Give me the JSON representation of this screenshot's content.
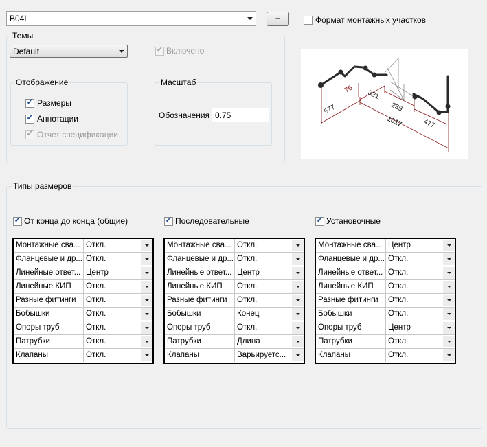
{
  "top": {
    "spec_combo_value": "B04L",
    "add_button_label": "+",
    "format_checkbox_label": "Формат монтажных участков",
    "format_checked": false
  },
  "themes": {
    "group_title": "Темы",
    "theme_combo_value": "Default",
    "enabled_label": "Включено",
    "enabled_checked": true,
    "display": {
      "title": "Отображение",
      "items": [
        {
          "label": "Размеры",
          "checked": true,
          "disabled": false
        },
        {
          "label": "Аннотации",
          "checked": true,
          "disabled": false
        },
        {
          "label": "Отчет спецификации",
          "checked": true,
          "disabled": true
        }
      ]
    },
    "scale": {
      "title": "Масштаб",
      "label": "Обозначения",
      "value": "0.75"
    }
  },
  "preview": {
    "dimensions": [
      "76",
      "321",
      "239",
      "577",
      "1017",
      "477"
    ],
    "line_color": "#2b2b2b",
    "dim_color": "#8a1b1b"
  },
  "dimension_types": {
    "title": "Типы размеров",
    "columns": [
      {
        "label": "От конца до конца (общие)",
        "checked": true,
        "rows": [
          {
            "name": "Монтажные сва...",
            "value": "Откл."
          },
          {
            "name": "Фланцевые и др...",
            "value": "Откл."
          },
          {
            "name": "Линейные ответ...",
            "value": "Центр"
          },
          {
            "name": "Линейные КИП",
            "value": "Откл."
          },
          {
            "name": "Разные фитинги",
            "value": "Откл."
          },
          {
            "name": "Бобышки",
            "value": "Откл."
          },
          {
            "name": "Опоры труб",
            "value": "Откл."
          },
          {
            "name": "Патрубки",
            "value": "Откл."
          },
          {
            "name": "Клапаны",
            "value": "Откл."
          }
        ]
      },
      {
        "label": "Последовательные",
        "checked": true,
        "rows": [
          {
            "name": "Монтажные сва...",
            "value": "Откл."
          },
          {
            "name": "Фланцевые и др...",
            "value": "Откл."
          },
          {
            "name": "Линейные ответ...",
            "value": "Центр"
          },
          {
            "name": "Линейные КИП",
            "value": "Откл."
          },
          {
            "name": "Разные фитинги",
            "value": "Откл."
          },
          {
            "name": "Бобышки",
            "value": "Конец"
          },
          {
            "name": "Опоры труб",
            "value": "Откл."
          },
          {
            "name": "Патрубки",
            "value": "Длина"
          },
          {
            "name": "Клапаны",
            "value": "Варьируетс..."
          }
        ]
      },
      {
        "label": "Установочные",
        "checked": true,
        "rows": [
          {
            "name": "Монтажные сва...",
            "value": "Центр"
          },
          {
            "name": "Фланцевые и др...",
            "value": "Откл."
          },
          {
            "name": "Линейные ответ...",
            "value": "Откл."
          },
          {
            "name": "Линейные КИП",
            "value": "Откл."
          },
          {
            "name": "Разные фитинги",
            "value": "Откл."
          },
          {
            "name": "Бобышки",
            "value": "Откл."
          },
          {
            "name": "Опоры труб",
            "value": "Центр"
          },
          {
            "name": "Патрубки",
            "value": "Откл."
          },
          {
            "name": "Клапаны",
            "value": "Откл."
          }
        ]
      }
    ]
  }
}
